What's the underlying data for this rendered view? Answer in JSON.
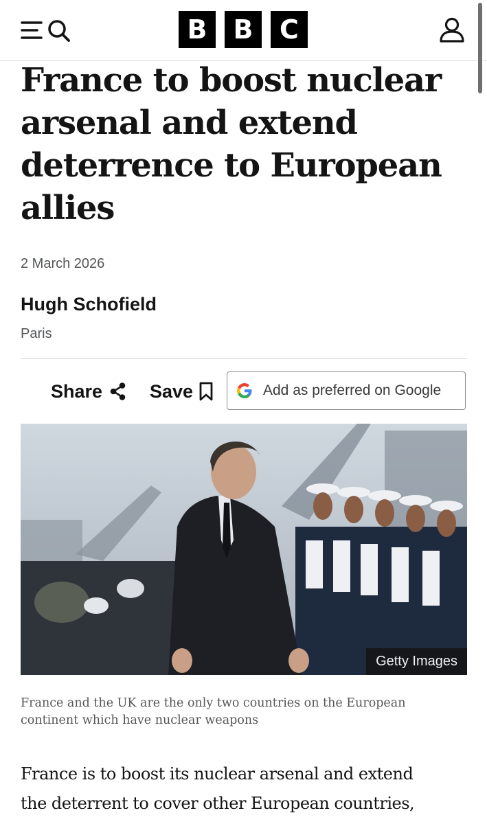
{
  "header": {
    "logo_letters": [
      "B",
      "B",
      "C"
    ],
    "icons": {
      "menu": "menu-icon",
      "search": "search-icon",
      "account": "account-icon"
    }
  },
  "article": {
    "headline_lines": [
      "France to boost nuclear",
      "arsenal and extend",
      "deterrence to European",
      "allies"
    ],
    "date": "2 March 2026",
    "author": "Hugh Schofield",
    "location": "Paris"
  },
  "actions": {
    "share_label": "Share",
    "save_label": "Save",
    "google_label": "Add as preferred on Google"
  },
  "image": {
    "credit": "Getty Images",
    "caption": "France and the UK are the only two countries on the European continent which have nuclear weapons"
  },
  "body": {
    "lines": [
      "France is to boost its nuclear arsenal and extend",
      "the deterrent to cover other European countries,"
    ]
  },
  "colors": {
    "text": "#141414",
    "secondary_text": "#545658",
    "logo_bg": "#000000"
  }
}
